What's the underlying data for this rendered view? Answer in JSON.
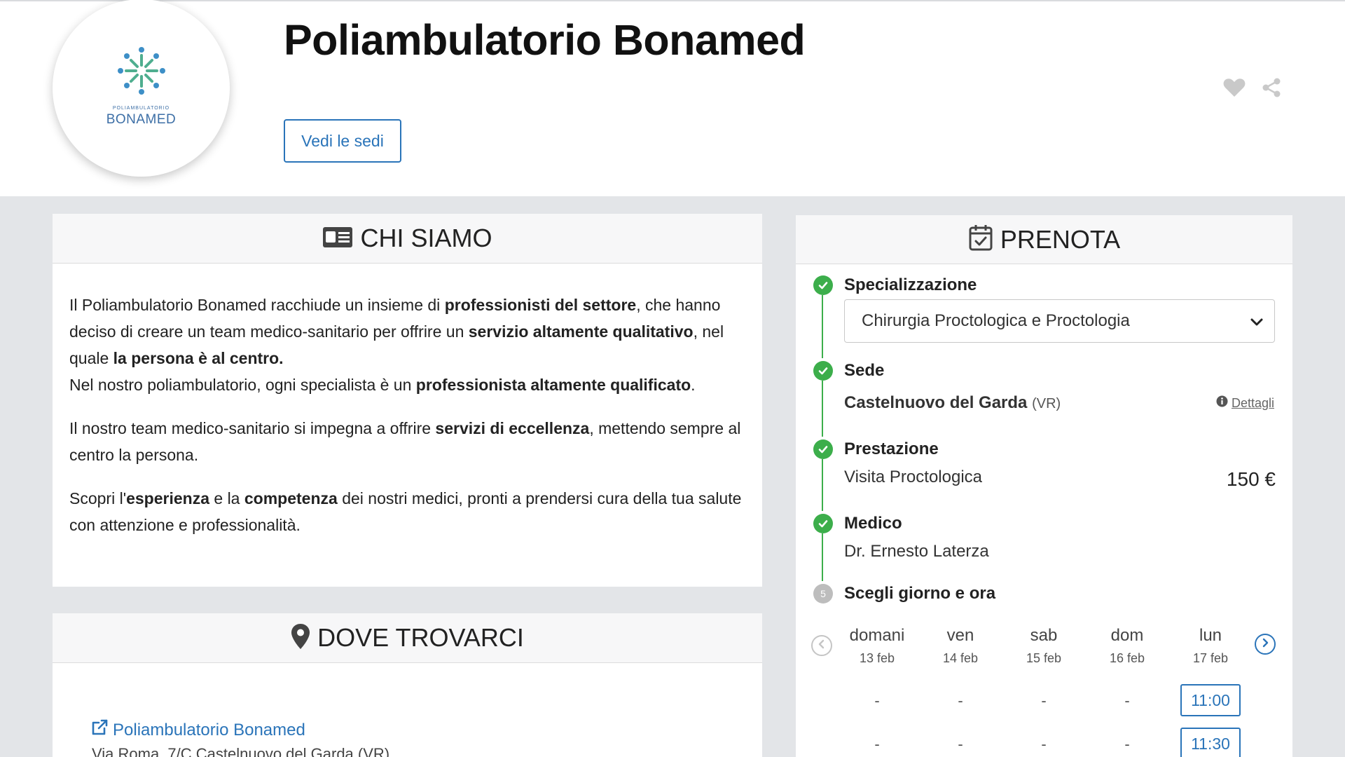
{
  "header": {
    "logo_small_text": "POLIAMBULATORIO",
    "logo_big_text": "BONAMED",
    "clinic_name": "Poliambulatorio Bonamed",
    "sedi_button": "Vedi le sedi",
    "icons": [
      "heart-icon",
      "share-icon"
    ]
  },
  "chi_siamo": {
    "title": "CHI SIAMO",
    "p1_parts": [
      "Il Poliambulatorio Bonamed racchiude un insieme di ",
      "professionisti del settore",
      ", che hanno deciso di creare un team medico-sanitario per offrire un ",
      "servizio altamente qualitativo",
      ", nel quale ",
      "la persona è al centro."
    ],
    "p2_parts": [
      "Nel nostro poliambulatorio, ogni specialista è un ",
      "professionista altamente qualificato",
      "."
    ],
    "p3_parts": [
      "Il nostro team medico-sanitario si impegna a offrire ",
      "servizi di eccellenza",
      ", mettendo sempre al centro la persona."
    ],
    "p4_parts": [
      "Scopri l'",
      "esperienza",
      " e la ",
      "competenza",
      " dei nostri medici, pronti a prendersi cura della tua salute con attenzione e professionalità."
    ]
  },
  "dove_trovarci": {
    "title": "DOVE TROVARCI",
    "link": "Poliambulatorio Bonamed",
    "address": "Via Roma, 7/C Castelnuovo del Garda (VR)"
  },
  "prenota": {
    "title": "PRENOTA",
    "steps": {
      "specializzazione": {
        "label": "Specializzazione",
        "value": "Chirurgia Proctologica e Proctologia"
      },
      "sede": {
        "label": "Sede",
        "value": "Castelnuovo del Garda",
        "province": "(VR)",
        "dettagli": "Dettagli"
      },
      "prestazione": {
        "label": "Prestazione",
        "value": "Visita Proctologica",
        "price": "150 €"
      },
      "medico": {
        "label": "Medico",
        "value": "Dr. Ernesto Laterza"
      },
      "giorno": {
        "label": "Scegli giorno e ora",
        "number": "5"
      }
    },
    "days": [
      {
        "name": "domani",
        "date": "13 feb"
      },
      {
        "name": "ven",
        "date": "14 feb"
      },
      {
        "name": "sab",
        "date": "15 feb"
      },
      {
        "name": "dom",
        "date": "16 feb"
      },
      {
        "name": "lun",
        "date": "17 feb"
      }
    ],
    "slot_rows": [
      [
        "-",
        "-",
        "-",
        "-",
        "11:00"
      ],
      [
        "-",
        "-",
        "-",
        "-",
        "11:30"
      ]
    ]
  },
  "colors": {
    "accent": "#2a74b9",
    "success": "#3cae4b",
    "logo": "#3d6fa6"
  }
}
